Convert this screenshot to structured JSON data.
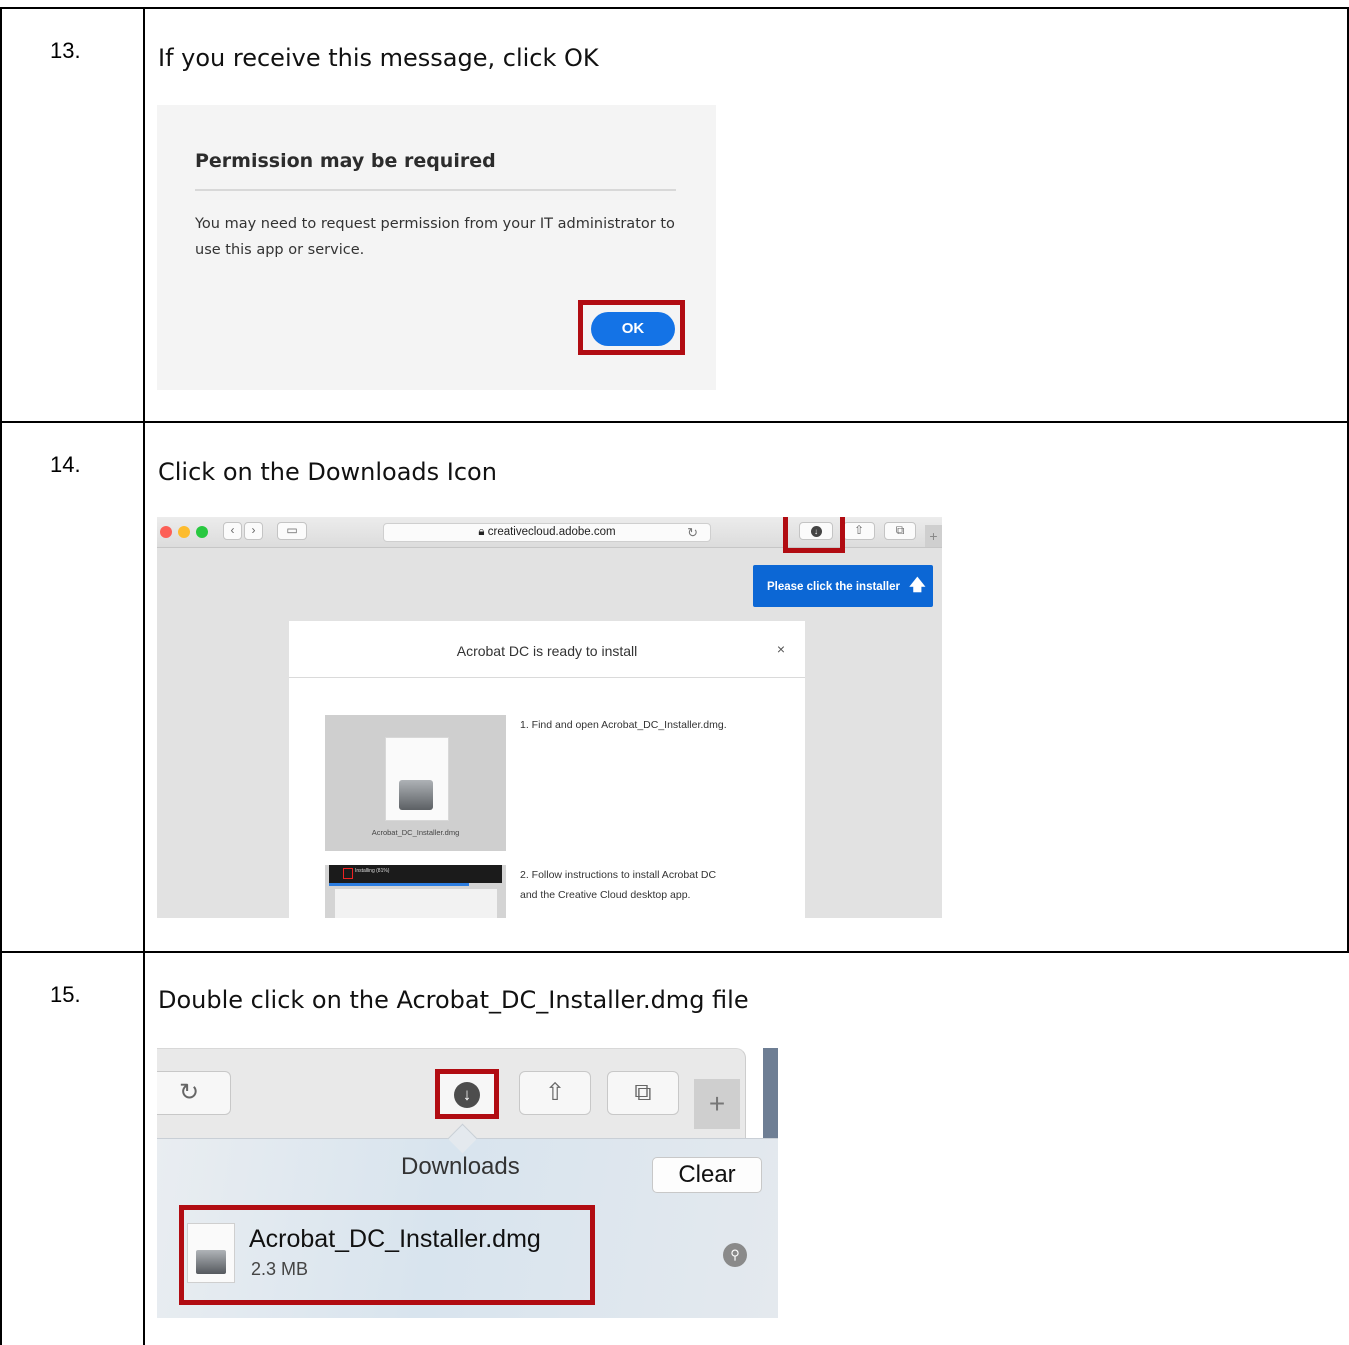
{
  "steps": [
    {
      "number": "13.",
      "instruction": "If you receive this message, click OK"
    },
    {
      "number": "14.",
      "instruction": "Click on the Downloads Icon"
    },
    {
      "number": "15.",
      "instruction": "Double click on the Acrobat_DC_Installer.dmg file"
    }
  ],
  "dialog": {
    "title": "Permission may be required",
    "body": "You may need to request permission from your IT administrator to use this app or service.",
    "ok_label": "OK"
  },
  "browser": {
    "url": "creativecloud.adobe.com",
    "tooltip": "Please click the installer",
    "modal_title": "Acrobat DC is ready to install",
    "close_label": "×",
    "file_caption": "Acrobat_DC_Installer.dmg",
    "step1": "1. Find and open Acrobat_DC_Installer.dmg.",
    "step2_line1": "2. Follow instructions to install Acrobat DC",
    "step2_line2": "and the Creative Cloud desktop app.",
    "installing_text": "Installing (81%)"
  },
  "downloads": {
    "title": "Downloads",
    "clear_label": "Clear",
    "file_name": "Acrobat_DC_Installer.dmg",
    "file_size": "2.3 MB"
  },
  "colors": {
    "highlight": "#b10c12",
    "adobe_blue": "#1473e6",
    "tooltip_blue": "#0c67d5"
  }
}
